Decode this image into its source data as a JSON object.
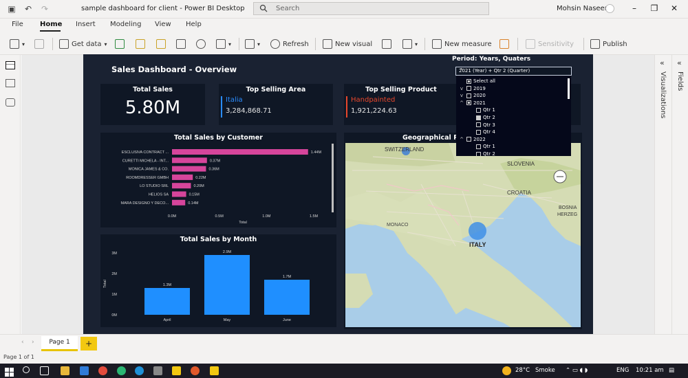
{
  "window": {
    "title": "sample dashboard for client - Power BI Desktop",
    "search_placeholder": "Search",
    "user": "Mohsin Naseem"
  },
  "menu": {
    "tabs": [
      "File",
      "Home",
      "Insert",
      "Modeling",
      "View",
      "Help"
    ],
    "active": "Home"
  },
  "ribbon": {
    "get_data": "Get data",
    "refresh": "Refresh",
    "new_visual": "New visual",
    "new_measure": "New measure",
    "sensitivity": "Sensitivity",
    "publish": "Publish"
  },
  "right_panes": {
    "visualizations": "Visualizations",
    "fields": "Fields"
  },
  "report": {
    "title": "Sales Dashboard - Overview",
    "total_sales": {
      "title": "Total Sales",
      "value": "5.80M"
    },
    "top_area": {
      "title": "Top Selling Area",
      "name": "Italia",
      "value": "3,284,868.71",
      "accent": "#2a8cff"
    },
    "top_product": {
      "title": "Top Selling Product",
      "name": "Handpainted",
      "value": "1,921,224.63",
      "accent": "#e8472c"
    },
    "slicer": {
      "label": "Period: Years, Quaters",
      "selected": "2021 (Year) + Qtr 2 (Quarter)",
      "items": [
        {
          "label": "Select all",
          "level": 0,
          "state": "partial",
          "expanded": ""
        },
        {
          "label": "2019",
          "level": 0,
          "state": "off",
          "expanded": "v"
        },
        {
          "label": "2020",
          "level": 0,
          "state": "off",
          "expanded": "v"
        },
        {
          "label": "2021",
          "level": 0,
          "state": "partial",
          "expanded": "^"
        },
        {
          "label": "Qtr 1",
          "level": 1,
          "state": "off",
          "expanded": ""
        },
        {
          "label": "Qtr 2",
          "level": 1,
          "state": "on",
          "expanded": ""
        },
        {
          "label": "Qtr 3",
          "level": 1,
          "state": "off",
          "expanded": ""
        },
        {
          "label": "Qtr 4",
          "level": 1,
          "state": "off",
          "expanded": ""
        },
        {
          "label": "2022",
          "level": 0,
          "state": "off",
          "expanded": "^"
        },
        {
          "label": "Qtr 1",
          "level": 1,
          "state": "off",
          "expanded": ""
        },
        {
          "label": "Qtr 2",
          "level": 1,
          "state": "off",
          "expanded": ""
        }
      ]
    },
    "map": {
      "title": "Geographical Re",
      "labels": [
        "SWITZERLAND",
        "SLOVENIA",
        "CROATIA",
        "BOSNIA",
        "HERZEG",
        "MONACO",
        "ITALY"
      ]
    },
    "status": "Page 1 of 1",
    "page_tab": "Page 1"
  },
  "chart_data": [
    {
      "type": "bar",
      "orientation": "horizontal",
      "title": "Total Sales by Customer",
      "xlabel": "Total",
      "categories": [
        "ESCLUSIVA CONTRACT ...",
        "CURETTI MICHELA - INT...",
        "MONICA JAMES & CO.",
        "ROOMDRESSER GMBH",
        "LO STUDIO SRL",
        "HELIOS SA",
        "MARA DESIGNO Y DECO..."
      ],
      "values": [
        1.44,
        0.37,
        0.36,
        0.22,
        0.2,
        0.15,
        0.14
      ],
      "data_labels": [
        "1.44M",
        "0.37M",
        "0.36M",
        "0.22M",
        "0.20M",
        "0.15M",
        "0.14M"
      ],
      "xticks": [
        "0.0M",
        "0.5M",
        "1.0M",
        "1.5M"
      ],
      "xlim": [
        0,
        1.5
      ],
      "color": "#d6459b"
    },
    {
      "type": "bar",
      "title": "Total Sales by Month",
      "ylabel": "Total",
      "categories": [
        "April",
        "May",
        "June"
      ],
      "values": [
        1.3,
        2.9,
        1.7
      ],
      "data_labels": [
        "1.3M",
        "2.9M",
        "1.7M"
      ],
      "yticks": [
        "0M",
        "1M",
        "2M",
        "3M"
      ],
      "ylim": [
        0,
        3
      ],
      "color": "#1f8fff"
    }
  ],
  "taskbar": {
    "temp": "28°C",
    "weather": "Smoke",
    "lang": "ENG",
    "time": "10:21 am"
  }
}
